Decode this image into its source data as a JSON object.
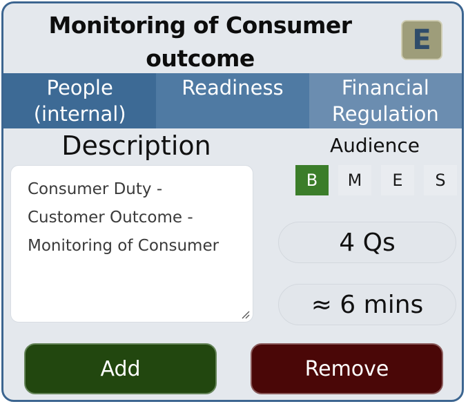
{
  "card": {
    "title": "Monitoring of Consumer outcome",
    "badge": "E"
  },
  "tabs": [
    {
      "label": "People (internal)"
    },
    {
      "label": "Readiness"
    },
    {
      "label": "Financial Regulation"
    }
  ],
  "description": {
    "heading": "Description",
    "text": "Consumer Duty - Customer Outcome - Monitoring of Consumer"
  },
  "audience": {
    "label": "Audience",
    "options": [
      "B",
      "M",
      "E",
      "S"
    ],
    "selected": "B"
  },
  "stats": {
    "questions": "4 Qs",
    "duration": "≈ 6 mins"
  },
  "actions": {
    "add_label": "Add",
    "remove_label": "Remove"
  },
  "colors": {
    "border": "#3c6590",
    "card_bg": "#e4e8ed",
    "tab_1": "#3d6a95",
    "tab_2": "#4f7aa3",
    "tab_3": "#6b8db0",
    "selected_option": "#3b7d2a",
    "add_button": "#22470f",
    "remove_button": "#4a0707",
    "badge_bg": "#9e9d7a"
  }
}
